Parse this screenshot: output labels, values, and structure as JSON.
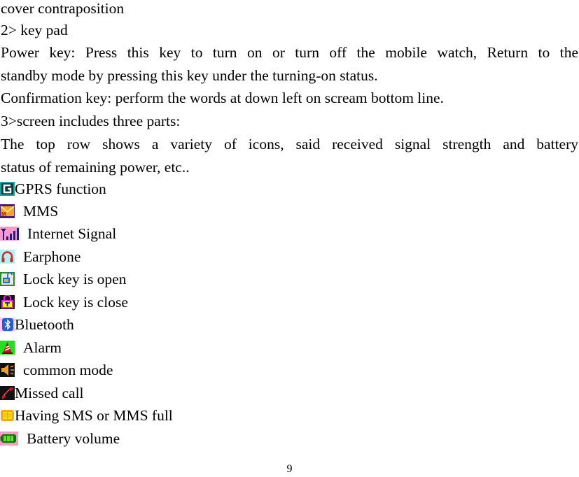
{
  "document": {
    "lines": [
      "cover contraposition",
      "2> key pad",
      "Power key: Press this key to turn on or turn off the mobile watch, Return to the",
      "standby mode by pressing this key under the turning-on status.",
      "Confirmation key: perform the words at down left on scream bottom line.",
      "3>screen includes three parts:",
      "The top row shows a variety of icons, said received signal strength and battery",
      "status of remaining power, etc.."
    ],
    "icon_legend": [
      {
        "icon": "gprs-icon",
        "label": "GPRS function"
      },
      {
        "icon": "mms-icon",
        "label": "MMS"
      },
      {
        "icon": "signal-icon",
        "label": "Internet Signal"
      },
      {
        "icon": "earphone-icon",
        "label": "Earphone"
      },
      {
        "icon": "lock-open-icon",
        "label": "Lock key is open"
      },
      {
        "icon": "lock-close-icon",
        "label": "Lock key is close"
      },
      {
        "icon": "bluetooth-icon",
        "label": "Bluetooth"
      },
      {
        "icon": "alarm-icon",
        "label": "Alarm"
      },
      {
        "icon": "speaker-icon",
        "label": "common mode"
      },
      {
        "icon": "missed-call-icon",
        "label": "Missed call"
      },
      {
        "icon": "sms-full-icon",
        "label": "Having SMS or MMS full"
      },
      {
        "icon": "battery-icon",
        "label": "Battery volume"
      }
    ],
    "page_number": "9"
  }
}
